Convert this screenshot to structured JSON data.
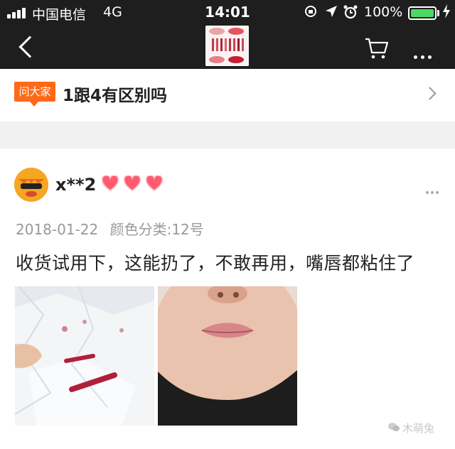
{
  "status_bar": {
    "carrier": "中国电信",
    "network": "4G",
    "time": "14:01",
    "battery": "100%"
  },
  "nav": {
    "icons": [
      "back-icon",
      "cart-icon",
      "more-icon"
    ]
  },
  "ask": {
    "badge": "问大家",
    "question": "1跟4有区别吗"
  },
  "review": {
    "username": "x**2",
    "level_hearts": 3,
    "date": "2018-01-22",
    "variant": "颜色分类:12号",
    "text": "收货试用下，这能扔了，不敢再用，嘴唇都粘住了"
  },
  "watermark": "木萌兔",
  "colors": {
    "accent": "#ff6a1a",
    "battery": "#4cd964",
    "heart": "#ff5a6e"
  }
}
